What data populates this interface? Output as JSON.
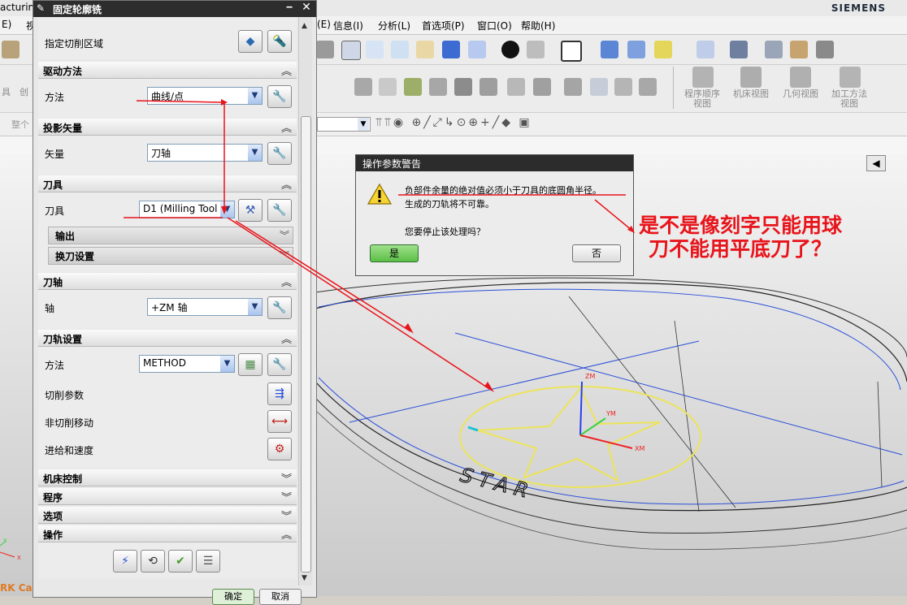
{
  "window": {
    "title_fragment": "acturing",
    "brand": "SIEMENS"
  },
  "menu": {
    "left_fragments": [
      "E)",
      "视"
    ],
    "items": [
      "(E)",
      "信息(I)",
      "分析(L)",
      "首选项(P)",
      "窗口(O)",
      "帮助(H)"
    ]
  },
  "toolbar": {
    "left_fragments": [
      "具",
      "创"
    ],
    "view_labels": [
      "程序顺序\n视图",
      "机床视图",
      "几何视图",
      "加工方法\n视图"
    ],
    "filter_fragment": "整个"
  },
  "panel": {
    "title": "固定轮廓铣",
    "specify_cut_region": "指定切削区域",
    "sections": {
      "drive_method": {
        "title": "驱动方法",
        "method_label": "方法",
        "method_value": "曲线/点"
      },
      "projection": {
        "title": "投影矢量",
        "vector_label": "矢量",
        "vector_value": "刀轴"
      },
      "tool": {
        "title": "刀具",
        "tool_label": "刀具",
        "tool_value": "D1 (Milling Tool",
        "output": "输出",
        "tool_change": "换刀设置"
      },
      "tool_axis": {
        "title": "刀轴",
        "axis_label": "轴",
        "axis_value": "+ZM 轴"
      },
      "path_settings": {
        "title": "刀轨设置",
        "method_label": "方法",
        "method_value": "METHOD",
        "cut_params": "切削参数",
        "non_cut_moves": "非切削移动",
        "feeds_speeds": "进给和速度"
      },
      "machine_control": {
        "title": "机床控制"
      },
      "program": {
        "title": "程序"
      },
      "options": {
        "title": "选项"
      },
      "actions": {
        "title": "操作"
      }
    },
    "ok": "确定",
    "cancel": "取消"
  },
  "warning": {
    "title": "操作参数警告",
    "line1": "负部件余量的绝对值必须小于刀具的底圆角半径。",
    "line2": "生成的刀轨将不可靠。",
    "question": "您要停止该处理吗？",
    "yes": "是",
    "no": "否"
  },
  "annotation": {
    "line1": "是不是像刻字只能用球",
    "line2": "刀不能用平底刀了？"
  },
  "model": {
    "text": "STAR",
    "axis_labels": {
      "z": "ZM",
      "y": "YM",
      "x": "XM"
    },
    "corner_label": "RK Ca",
    "triad": {
      "y": "Y",
      "x": "X"
    }
  },
  "colors": {
    "annotation_red": "#e8141b",
    "curve_yellow": "#ece45a",
    "edge_blue": "#2a4fd8",
    "accent_green": "#5cbf45"
  }
}
